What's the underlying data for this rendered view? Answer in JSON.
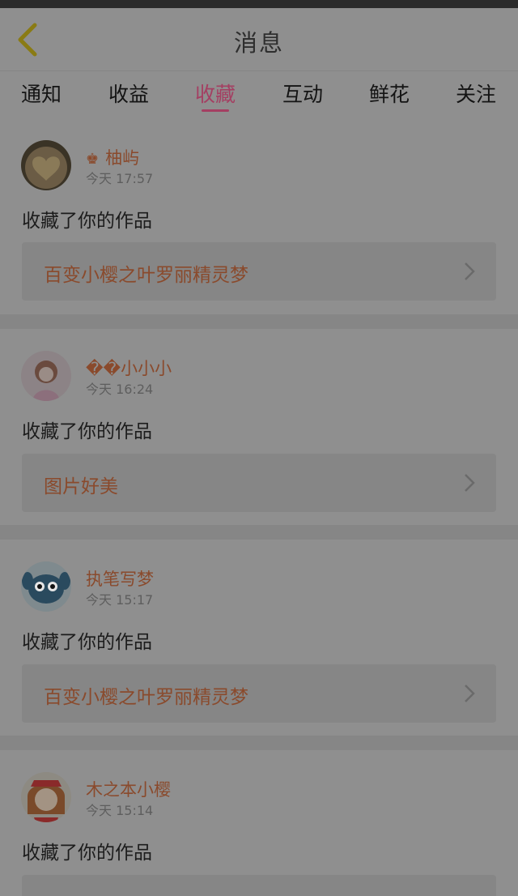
{
  "header": {
    "title": "消息"
  },
  "tabs": [
    {
      "label": "通知"
    },
    {
      "label": "收益"
    },
    {
      "label": "收藏",
      "active": true
    },
    {
      "label": "互动"
    },
    {
      "label": "鲜花"
    },
    {
      "label": "关注"
    }
  ],
  "messages": [
    {
      "name": "柚屿",
      "time": "今天  17:57",
      "action": "收藏了你的作品",
      "work": "百变小樱之叶罗丽精灵梦"
    },
    {
      "name": "��小小小",
      "time": "今天  16:24",
      "action": "收藏了你的作品",
      "work": "图片好美"
    },
    {
      "name": "执笔写梦",
      "time": "今天  15:17",
      "action": "收藏了你的作品",
      "work": "百变小樱之叶罗丽精灵梦"
    },
    {
      "name": "木之本小樱",
      "time": "今天  15:14",
      "action": "收藏了你的作品",
      "work": ""
    }
  ],
  "colors": {
    "accent": "#a43f62",
    "username": "#8a4a2c",
    "overlay_bg": "#8f8f8f"
  }
}
